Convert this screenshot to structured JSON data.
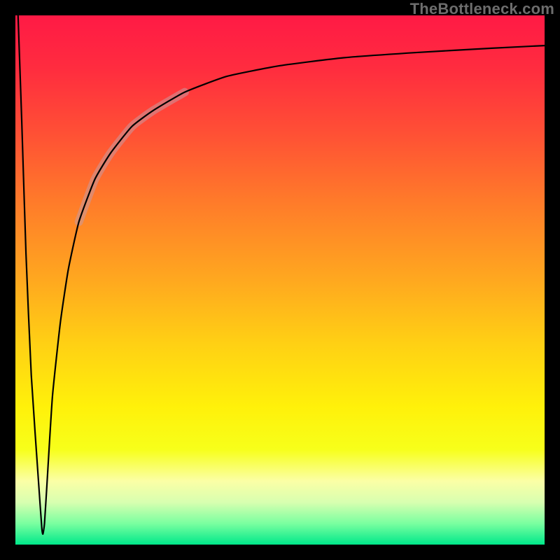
{
  "attribution": "TheBottleneck.com",
  "gradient_stops": [
    {
      "offset": 0.0,
      "color": "#ff1a45"
    },
    {
      "offset": 0.1,
      "color": "#ff2c3f"
    },
    {
      "offset": 0.22,
      "color": "#ff4f35"
    },
    {
      "offset": 0.35,
      "color": "#ff7a2a"
    },
    {
      "offset": 0.5,
      "color": "#ffa81f"
    },
    {
      "offset": 0.62,
      "color": "#ffd014"
    },
    {
      "offset": 0.74,
      "color": "#fff10a"
    },
    {
      "offset": 0.82,
      "color": "#f7ff1a"
    },
    {
      "offset": 0.88,
      "color": "#fbffa6"
    },
    {
      "offset": 0.92,
      "color": "#d8ffb0"
    },
    {
      "offset": 0.96,
      "color": "#7affa0"
    },
    {
      "offset": 1.0,
      "color": "#00e88a"
    }
  ],
  "curve": {
    "stroke": "#000000",
    "stroke_width": 2.2,
    "highlight": {
      "stroke": "#c79aa0",
      "stroke_width": 12,
      "opacity": 0.55
    }
  },
  "chart_data": {
    "type": "line",
    "title": "",
    "xlabel": "",
    "ylabel": "",
    "xlim": [
      0,
      100
    ],
    "ylim": [
      0,
      100
    ],
    "grid": false,
    "legend": false,
    "series": [
      {
        "name": "bottleneck-curve",
        "x": [
          0.5,
          1.2,
          2.0,
          3.0,
          4.5,
          5.0,
          5.2,
          5.5,
          6.0,
          7.0,
          8.5,
          10,
          12,
          15,
          18,
          22,
          26,
          32,
          40,
          50,
          62,
          76,
          90,
          100
        ],
        "y": [
          100,
          80,
          55,
          32,
          10,
          3,
          2,
          4,
          12,
          28,
          42,
          52,
          61,
          69,
          74,
          79,
          82,
          85.5,
          88.5,
          90.5,
          92,
          93,
          93.8,
          94.3
        ]
      }
    ],
    "highlight_segment": {
      "series": "bottleneck-curve",
      "x_start": 15,
      "x_end": 26
    }
  }
}
